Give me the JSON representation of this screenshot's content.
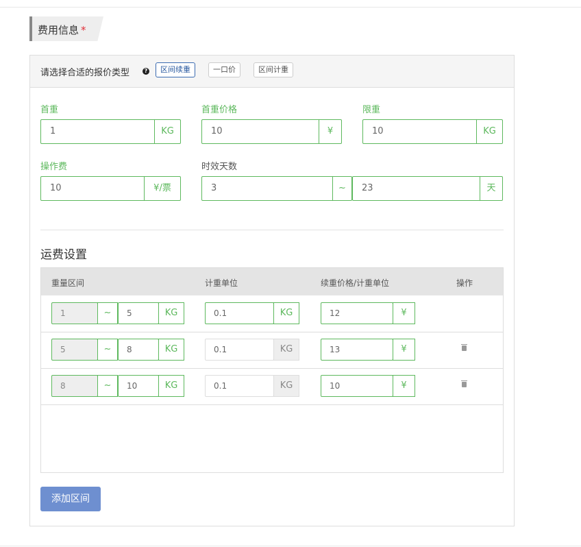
{
  "section": {
    "title": "费用信息",
    "required_mark": "*"
  },
  "quote_type": {
    "label": "请选择合适的报价类型",
    "help_icon": "question-circle-icon",
    "options": [
      "区间续重",
      "一口价",
      "区间计重"
    ],
    "selected": "区间续重"
  },
  "fields": {
    "first_weight": {
      "label": "首重",
      "value": "1",
      "unit": "KG"
    },
    "first_weight_price": {
      "label": "首重价格",
      "value": "10",
      "unit": "¥"
    },
    "weight_limit": {
      "label": "限重",
      "value": "10",
      "unit": "KG"
    },
    "handling_fee": {
      "label": "操作费",
      "value": "10",
      "unit": "¥/票"
    },
    "delivery_days": {
      "label": "时效天数",
      "from": "3",
      "separator": "~",
      "to": "23",
      "unit": "天"
    }
  },
  "freight": {
    "title": "运费设置",
    "columns": [
      "重量区间",
      "计重单位",
      "续重价格/计重单位",
      "操作"
    ],
    "rows": [
      {
        "from": "1",
        "sep": "~",
        "to": "5",
        "range_unit": "KG",
        "unit_value": "0.1",
        "unit_unit": "KG",
        "price": "12",
        "price_unit": "¥",
        "deletable": false
      },
      {
        "from": "5",
        "sep": "~",
        "to": "8",
        "range_unit": "KG",
        "unit_value": "0.1",
        "unit_unit": "KG",
        "price": "13",
        "price_unit": "¥",
        "deletable": true
      },
      {
        "from": "8",
        "sep": "~",
        "to": "10",
        "range_unit": "KG",
        "unit_value": "0.1",
        "unit_unit": "KG",
        "price": "10",
        "price_unit": "¥",
        "deletable": true
      }
    ],
    "delete_icon": "trash-icon"
  },
  "add_button": "添加区间",
  "colors": {
    "green": "#5cb85c",
    "primary": "#6e8fd0",
    "active_border": "#3a6ab0"
  }
}
